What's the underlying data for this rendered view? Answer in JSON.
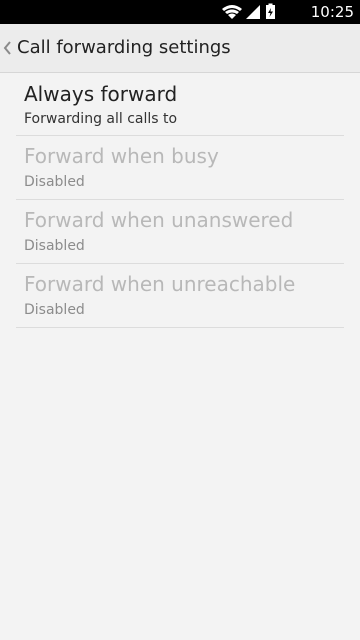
{
  "status_bar": {
    "time": "10:25",
    "icons": [
      "wifi-icon",
      "signal-icon",
      "battery-icon"
    ]
  },
  "action_bar": {
    "title": "Call forwarding settings",
    "back_icon": "chevron-left-icon"
  },
  "items": [
    {
      "title": "Always forward",
      "summary": "Forwarding all calls to",
      "enabled": true
    },
    {
      "title": "Forward when busy",
      "summary": "Disabled",
      "enabled": false
    },
    {
      "title": "Forward when unanswered",
      "summary": "Disabled",
      "enabled": false
    },
    {
      "title": "Forward when unreachable",
      "summary": "Disabled",
      "enabled": false
    }
  ],
  "colors": {
    "background": "#f3f3f3",
    "action_bar": "#ececec",
    "status_bar": "#000000",
    "divider": "#dcdcdc",
    "disabled_text": "#b8b8b8"
  }
}
